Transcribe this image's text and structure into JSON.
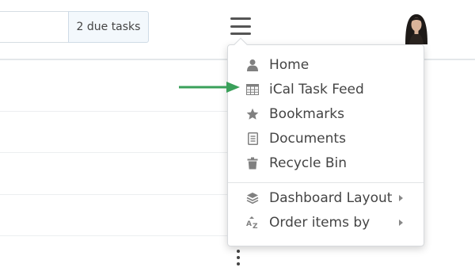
{
  "header": {
    "due_tasks": "2 due tasks"
  },
  "menu": {
    "items": [
      {
        "label": "Home",
        "icon": "user-icon"
      },
      {
        "label": "iCal Task Feed",
        "icon": "calendar-grid-icon"
      },
      {
        "label": "Bookmarks",
        "icon": "star-icon"
      },
      {
        "label": "Documents",
        "icon": "document-icon"
      },
      {
        "label": "Recycle Bin",
        "icon": "trash-icon"
      },
      {
        "label": "Dashboard Layout",
        "icon": "layers-icon",
        "submenu": true
      },
      {
        "label": "Order items by",
        "icon": "sort-az-icon",
        "submenu": true
      }
    ]
  },
  "colors": {
    "annotation_arrow": "#3aa05a",
    "icon_gray": "#808080"
  }
}
